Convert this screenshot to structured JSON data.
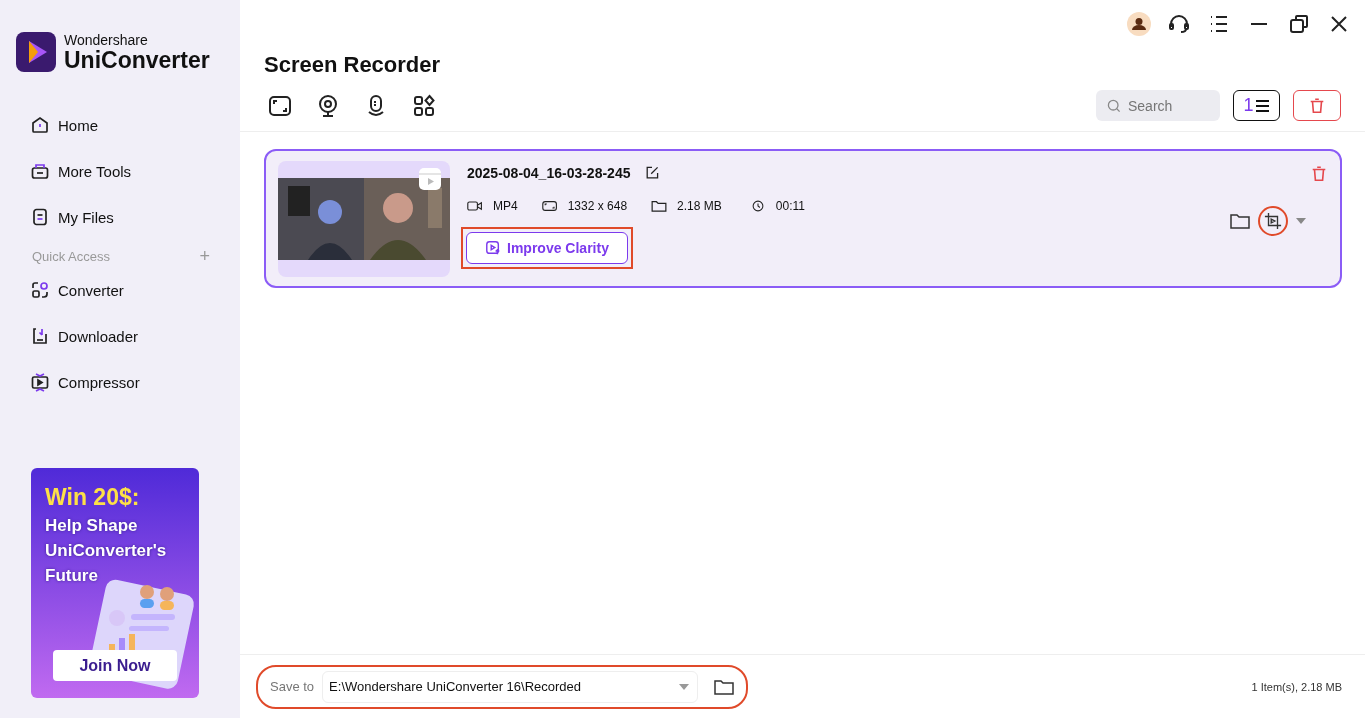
{
  "app": {
    "brand_small": "Wondershare",
    "brand_large": "UniConverter"
  },
  "nav": [
    {
      "label": "Home",
      "kind": "home"
    },
    {
      "label": "More Tools",
      "kind": "tools"
    },
    {
      "label": "My Files",
      "kind": "files"
    }
  ],
  "quick_access": {
    "label": "Quick Access",
    "add": "+"
  },
  "quick_items": [
    {
      "label": "Converter",
      "kind": "converter"
    },
    {
      "label": "Downloader",
      "kind": "downloader"
    },
    {
      "label": "Compressor",
      "kind": "compressor"
    }
  ],
  "promo": {
    "headline": "Win 20$:",
    "text": "Help Shape UniConverter's Future",
    "button": "Join Now"
  },
  "page_title": "Screen Recorder",
  "search": {
    "placeholder": "Search"
  },
  "sort_button": {
    "glyph": "1"
  },
  "recordings": [
    {
      "name": "2025-08-04_16-03-28-245",
      "format": "MP4",
      "resolution": "1332 x 648",
      "size": "2.18 MB",
      "duration": "00:11",
      "action": "Improve Clarity",
      "action_highlighted": true,
      "crop_highlighted": true
    }
  ],
  "save": {
    "label": "Save to",
    "path": "E:\\Wondershare UniConverter 16\\Recorded",
    "highlighted": true
  },
  "status": "1 Item(s), 2.18 MB"
}
